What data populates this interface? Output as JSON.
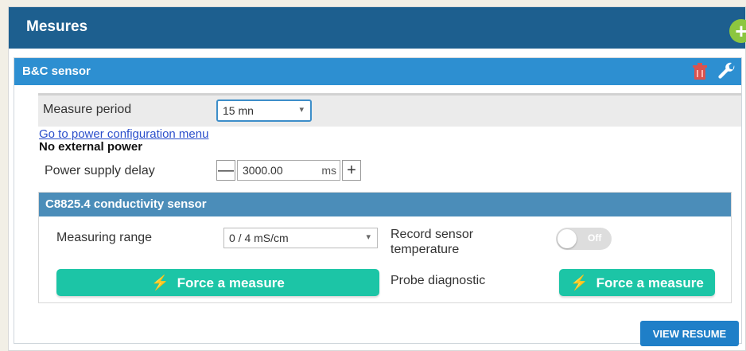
{
  "header": {
    "title": "Mesures"
  },
  "card": {
    "title": "B&C sensor"
  },
  "period": {
    "label": "Measure period",
    "value": "15 mn"
  },
  "power": {
    "link": "Go to power configuration menu",
    "status": "No external power",
    "delay_label": "Power supply delay",
    "delay_value": "3000.00",
    "delay_unit": "ms",
    "minus": "—",
    "plus": "+"
  },
  "sensor": {
    "title": "C8825.4 conductivity sensor",
    "range_label": "Measuring range",
    "range_value": "0 / 4 mS/cm",
    "record_label": "Record sensor temperature",
    "toggle_text": "Off",
    "force_label": "Force a measure",
    "diag_label": "Probe diagnostic",
    "diag_force_label": "Force a measure"
  },
  "footer": {
    "view_resume": "VIEW RESUME"
  },
  "colors": {
    "header": "#1d5f8f",
    "card_header": "#2d8fd1",
    "sensor_header": "#4b8db9",
    "accent_button": "#1cc5a6",
    "add_button": "#8cc63f",
    "delete_icon": "#d9534f"
  },
  "icons": {
    "add": "plus-circle-icon",
    "delete": "trash-icon",
    "settings": "wrench-icon",
    "bolt": "bolt-icon"
  }
}
